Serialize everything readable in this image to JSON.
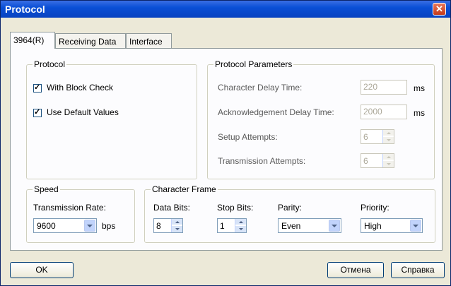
{
  "window": {
    "title": "Protocol",
    "close_glyph": "✕"
  },
  "tabs": [
    {
      "label": "3964(R)",
      "active": true
    },
    {
      "label": "Receiving Data",
      "active": false
    },
    {
      "label": "Interface",
      "active": false
    }
  ],
  "protocol_group": {
    "label": "Protocol",
    "with_block_check": {
      "label": "With Block Check",
      "checked": true
    },
    "use_default_values": {
      "label": "Use Default Values",
      "checked": true
    }
  },
  "parameters_group": {
    "label": "Protocol Parameters",
    "character_delay": {
      "label": "Character Delay Time:",
      "value": "220",
      "unit": "ms"
    },
    "ack_delay": {
      "label": "Acknowledgement Delay Time:",
      "value": "2000",
      "unit": "ms"
    },
    "setup_attempts": {
      "label": "Setup Attempts:",
      "value": "6"
    },
    "transmission_attempts": {
      "label": "Transmission Attempts:",
      "value": "6"
    }
  },
  "speed_group": {
    "label": "Speed",
    "rate_label": "Transmission Rate:",
    "rate_value": "9600",
    "rate_unit": "bps"
  },
  "frame_group": {
    "label": "Character Frame",
    "data_bits": {
      "label": "Data Bits:",
      "value": "8"
    },
    "stop_bits": {
      "label": "Stop Bits:",
      "value": "1"
    },
    "parity": {
      "label": "Parity:",
      "value": "Even"
    },
    "priority": {
      "label": "Priority:",
      "value": "High"
    }
  },
  "buttons": {
    "ok": "OK",
    "cancel": "Отмена",
    "help": "Справка"
  }
}
